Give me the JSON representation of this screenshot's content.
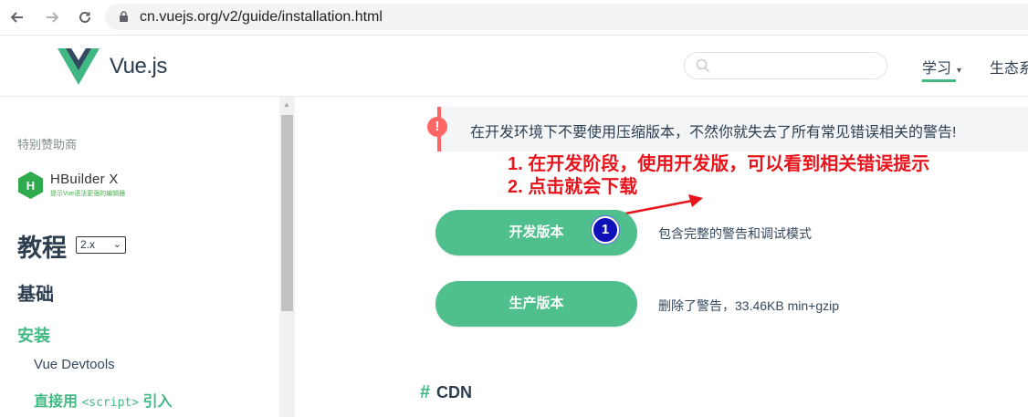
{
  "browser": {
    "url": "cn.vuejs.org/v2/guide/installation.html",
    "back_icon": "arrow-left-icon",
    "forward_icon": "arrow-right-icon",
    "reload_icon": "reload-icon",
    "lock_icon": "lock-icon"
  },
  "header": {
    "brand": "Vue.js",
    "search_placeholder": "",
    "nav": [
      {
        "label": "学习",
        "caret": "▾",
        "active": true
      },
      {
        "label": "生态系"
      }
    ]
  },
  "sidebar": {
    "sponsor_label": "特别赞助商",
    "sponsor_name": "HBuilder X",
    "sponsor_tagline": "提示Vue语法更强的编辑器",
    "sponsor_logo_letter": "H",
    "tutorial_title": "教程",
    "version_select": "2.x",
    "section_basic": "基础",
    "section_install": "安装",
    "items": [
      {
        "label": "Vue Devtools"
      },
      {
        "label_prefix": "直接用 ",
        "label_code": "<script>",
        "label_suffix": " 引入"
      }
    ]
  },
  "main": {
    "warning_text": "在开发环境下不要使用压缩版本，不然你就失去了所有常见错误相关的警告!",
    "warning_icon": "!",
    "annotation_line1": "1. 在开发阶段，使用开发版，可以看到相关错误提示",
    "annotation_line2": "2. 点击就会下载",
    "marker_number": "1",
    "dev_button": "开发版本",
    "dev_desc": "包含完整的警告和调试模式",
    "prod_button": "生产版本",
    "prod_desc": "删除了警告，33.46KB min+gzip",
    "cdn_hash": "#",
    "cdn_heading": "CDN"
  },
  "colors": {
    "accent": "#42b983",
    "button": "#4fc08d",
    "warning": "#ff6666",
    "annotation": "#e8141c",
    "marker": "#1010b8"
  }
}
